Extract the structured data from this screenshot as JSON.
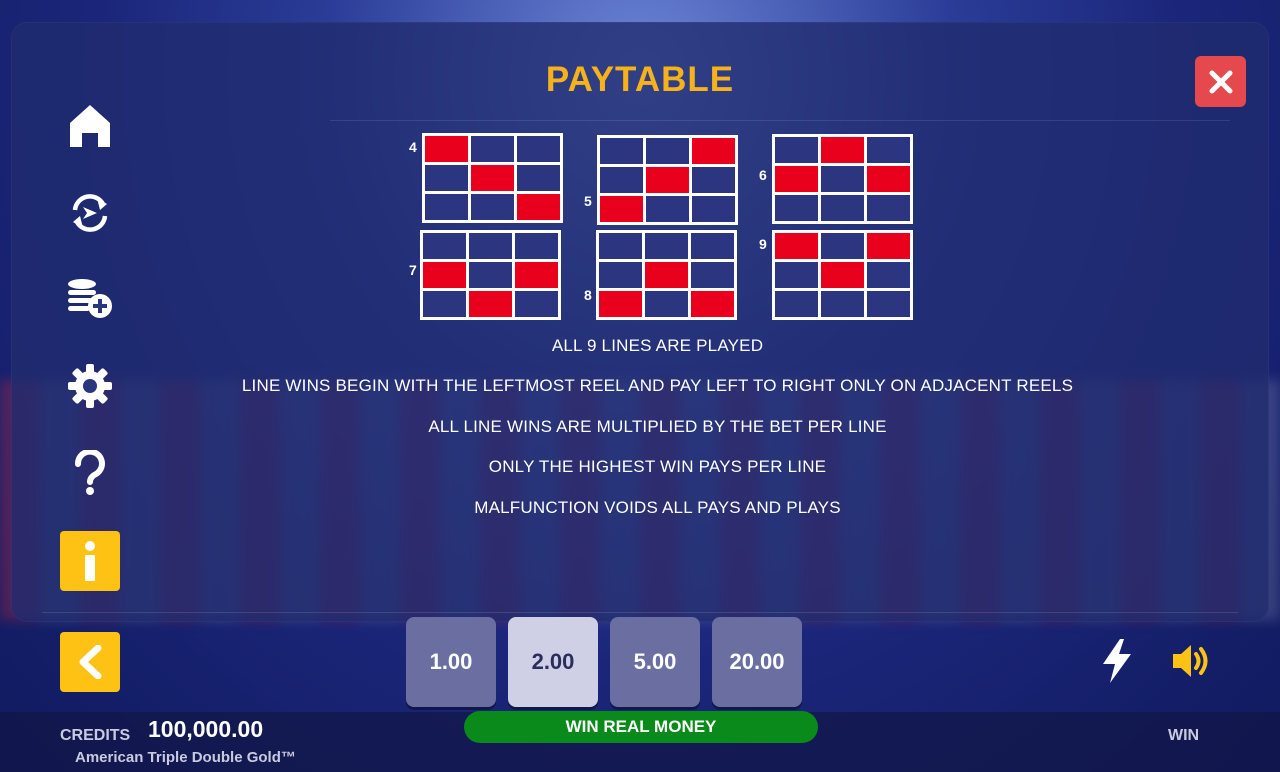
{
  "header": {
    "title": "PAYTABLE"
  },
  "colors": {
    "accent_yellow": "#fdc213",
    "title_orange": "#f5b21a",
    "close_red": "#e5484d",
    "line_red": "#e8001c",
    "win_green": "#0a8a1a"
  },
  "sidebar": {
    "items": [
      {
        "icon": "home-icon"
      },
      {
        "icon": "autoplay-icon"
      },
      {
        "icon": "add-coins-icon"
      },
      {
        "icon": "gear-icon"
      },
      {
        "icon": "question-icon"
      },
      {
        "icon": "info-icon",
        "active": true
      }
    ]
  },
  "paylines": [
    {
      "number": "4",
      "cells": [
        [
          1,
          0,
          0
        ],
        [
          0,
          1,
          0
        ],
        [
          0,
          0,
          1
        ]
      ]
    },
    {
      "number": "5",
      "cells": [
        [
          0,
          0,
          1
        ],
        [
          0,
          1,
          0
        ],
        [
          1,
          0,
          0
        ]
      ]
    },
    {
      "number": "6",
      "cells": [
        [
          0,
          1,
          0
        ],
        [
          1,
          0,
          1
        ],
        [
          0,
          0,
          0
        ]
      ]
    },
    {
      "number": "7",
      "cells": [
        [
          0,
          0,
          0
        ],
        [
          1,
          0,
          1
        ],
        [
          0,
          1,
          0
        ]
      ]
    },
    {
      "number": "8",
      "cells": [
        [
          0,
          0,
          0
        ],
        [
          0,
          1,
          0
        ],
        [
          1,
          0,
          1
        ]
      ]
    },
    {
      "number": "9",
      "cells": [
        [
          1,
          0,
          1
        ],
        [
          0,
          1,
          0
        ],
        [
          0,
          0,
          0
        ]
      ]
    }
  ],
  "rules": [
    "ALL 9 LINES ARE PLAYED",
    "LINE WINS BEGIN WITH THE LEFTMOST REEL AND PAY LEFT TO RIGHT ONLY ON ADJACENT REELS",
    "ALL LINE WINS ARE MULTIPLIED BY THE BET PER LINE",
    "ONLY THE HIGHEST WIN PAYS PER LINE",
    "MALFUNCTION VOIDS ALL PAYS AND PLAYS"
  ],
  "bets": {
    "options": [
      "1.00",
      "2.00",
      "5.00",
      "20.00"
    ],
    "selected": "2.00"
  },
  "footer": {
    "credits_label": "CREDITS",
    "credits_value": "100,000.00",
    "game_name": "American Triple Double Gold™",
    "win_real_money": "WIN REAL MONEY",
    "win_label": "WIN"
  }
}
